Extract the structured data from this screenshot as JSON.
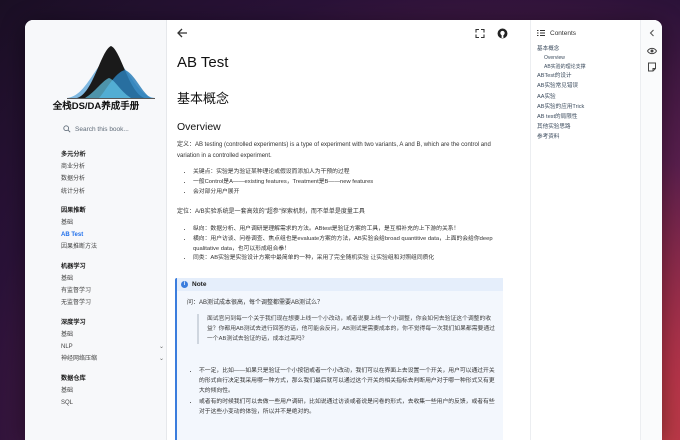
{
  "sidebar": {
    "title": "全栈DS/DA养成手册",
    "search_placeholder": "Search this book...",
    "groups": [
      {
        "title": "多元分析",
        "items": [
          "商业分析",
          "数据分析",
          "统计分析"
        ]
      },
      {
        "title": "因果推断",
        "items": [
          "基础",
          "AB Test",
          "因果推断方法"
        ]
      },
      {
        "title": "机器学习",
        "items": [
          "基础",
          "有监督学习",
          "无监督学习"
        ]
      },
      {
        "title": "深度学习",
        "items": [
          "基础",
          "NLP",
          "神经网络压缩"
        ]
      },
      {
        "title": "数据仓库",
        "items": [
          "基础",
          "SQL"
        ]
      }
    ],
    "active_item": "AB Test"
  },
  "main": {
    "page_title": "AB Test",
    "h2_concept": "基本概念",
    "h2_overview": "Overview",
    "definition": "定义：AB testing (controlled experiments) is a type of experiment with two variants, A and B, which are the control and variation in a controlled experiment.",
    "bullets1": [
      "关键点：实验是为验证某种理论或假设而添加人为干预的过程",
      "一般Control是A——existing features，Treatment是B——new features",
      "会对部分用户展开"
    ],
    "positioning": "定位：A/B实验系统是一套高效的\"超参\"探索机制，而不单单是度量工具",
    "bullets2": [
      "纵向：数据分析、用户调研是理解需求的方法。ABtest是验证方案的工具，是互相补充的上下游的关系！",
      "横向：用户访谈、问卷调查、焦点组也是evaluate方案的方法，AB实验会给broad quantitive data，上面的会给你deep qualitative data，也可以形成组合拳！",
      "同类：AB实验是实验设计方案中最简单的一种，采用了完全随机实验 让实验组和对照组同质化"
    ],
    "note": {
      "label": "Note",
      "question": "问：AB测试成本很高，每个调整都需要AB测试么？",
      "quote": "面试官问到每一个关于我们现在想要上线一个小改动，或者说要上线一个小调整，你会如何去验证这个调整的收益？你都用AB测试去进行回答的话，他可能会反问，AB测试是需要成本的，你不觉得每一次我们如果都需要通过一个AB测试去验证的话，成本过高吗？",
      "answers": [
        "不一定，比如——如果只是验证一个小按钮或者一个小改动，我们可以在界面上去设置一个开关，用户可以通过开关的形式自行决定我采用哪一种方式，那么我们最后就可以通过这个开关的相关指标去判断用户对于哪一种形式又有更大的倾向性。",
        "或者有的时候我们可以去做一些用户调研，比如说通过访谈或者说是问卷的形式，去收集一些用户的反馈，或者有些对于这些小变动的体验，所以并不是绝对的。"
      ]
    }
  },
  "toc": {
    "heading": "Contents",
    "items": [
      {
        "label": "基本概念",
        "sub": false
      },
      {
        "label": "Overview",
        "sub": true
      },
      {
        "label": "AB实验的理论支撑",
        "sub": true
      },
      {
        "label": "ABTest的设计",
        "sub": false
      },
      {
        "label": "AB实验常见错误",
        "sub": false
      },
      {
        "label": "AA实验",
        "sub": false
      },
      {
        "label": "AB实验的应用Trick",
        "sub": false
      },
      {
        "label": "AB test的局限性",
        "sub": false
      },
      {
        "label": "其他实验思路",
        "sub": false
      },
      {
        "label": "参考资料",
        "sub": false
      }
    ]
  },
  "colors": {
    "accent": "#1f6feb",
    "note_border": "#3b7ddd",
    "note_bg": "#f3f7fd"
  },
  "icons": [
    "back-arrow-icon",
    "fullscreen-icon",
    "github-icon",
    "download-icon",
    "toc-list-icon",
    "collapse-chevron-icon",
    "eye-icon",
    "note-icon",
    "search-icon"
  ]
}
